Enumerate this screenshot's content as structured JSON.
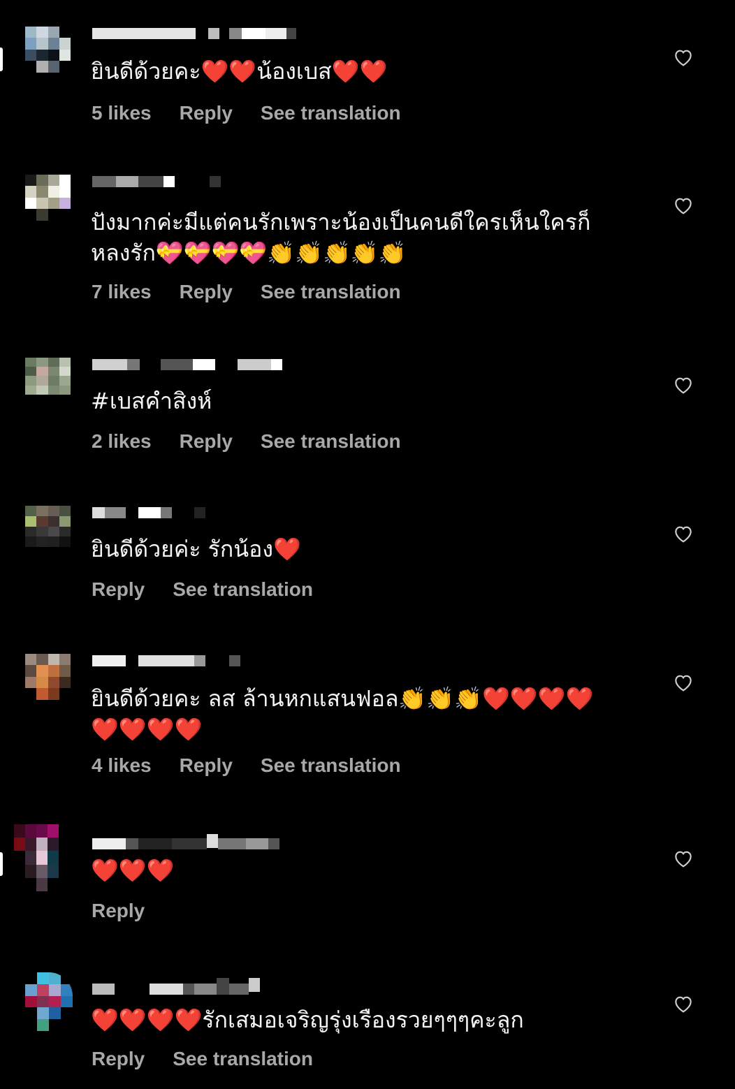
{
  "comments": [
    {
      "text": "ยินดีด้วยคะ❤️❤️น้องเบส❤️❤️",
      "likes": "5 likes",
      "reply": "Reply",
      "translate": "See translation"
    },
    {
      "text": "ปังมากค่ะมีแต่คนรักเพราะน้องเป็นคนดีใครเห็นใครก็หลงรัก💝💝💝💝👏👏👏👏👏",
      "likes": "7 likes",
      "reply": "Reply",
      "translate": "See translation"
    },
    {
      "text": "#เบสคำสิงห์",
      "likes": "2 likes",
      "reply": "Reply",
      "translate": "See translation"
    },
    {
      "text": "ยินดีด้วยค่ะ รักน้อง❤️",
      "reply": "Reply",
      "translate": "See translation"
    },
    {
      "text": "ยินดีด้วยคะ ลส ล้านหกแสนฟอล👏👏👏❤️❤️❤️❤️❤️❤️❤️❤️",
      "likes": "4 likes",
      "reply": "Reply",
      "translate": "See translation"
    },
    {
      "text": "❤️❤️❤️",
      "reply": "Reply"
    },
    {
      "text": "❤️❤️❤️❤️รักเสมอเจริญรุ่งเรืองรวยๆๆๆคะลูก",
      "reply": "Reply",
      "translate": "See translation"
    }
  ],
  "icons": {
    "like": "heart-outline-icon"
  },
  "colors": {
    "background": "#000000",
    "text": "#f5f5f5",
    "meta": "#a8a8a8"
  }
}
